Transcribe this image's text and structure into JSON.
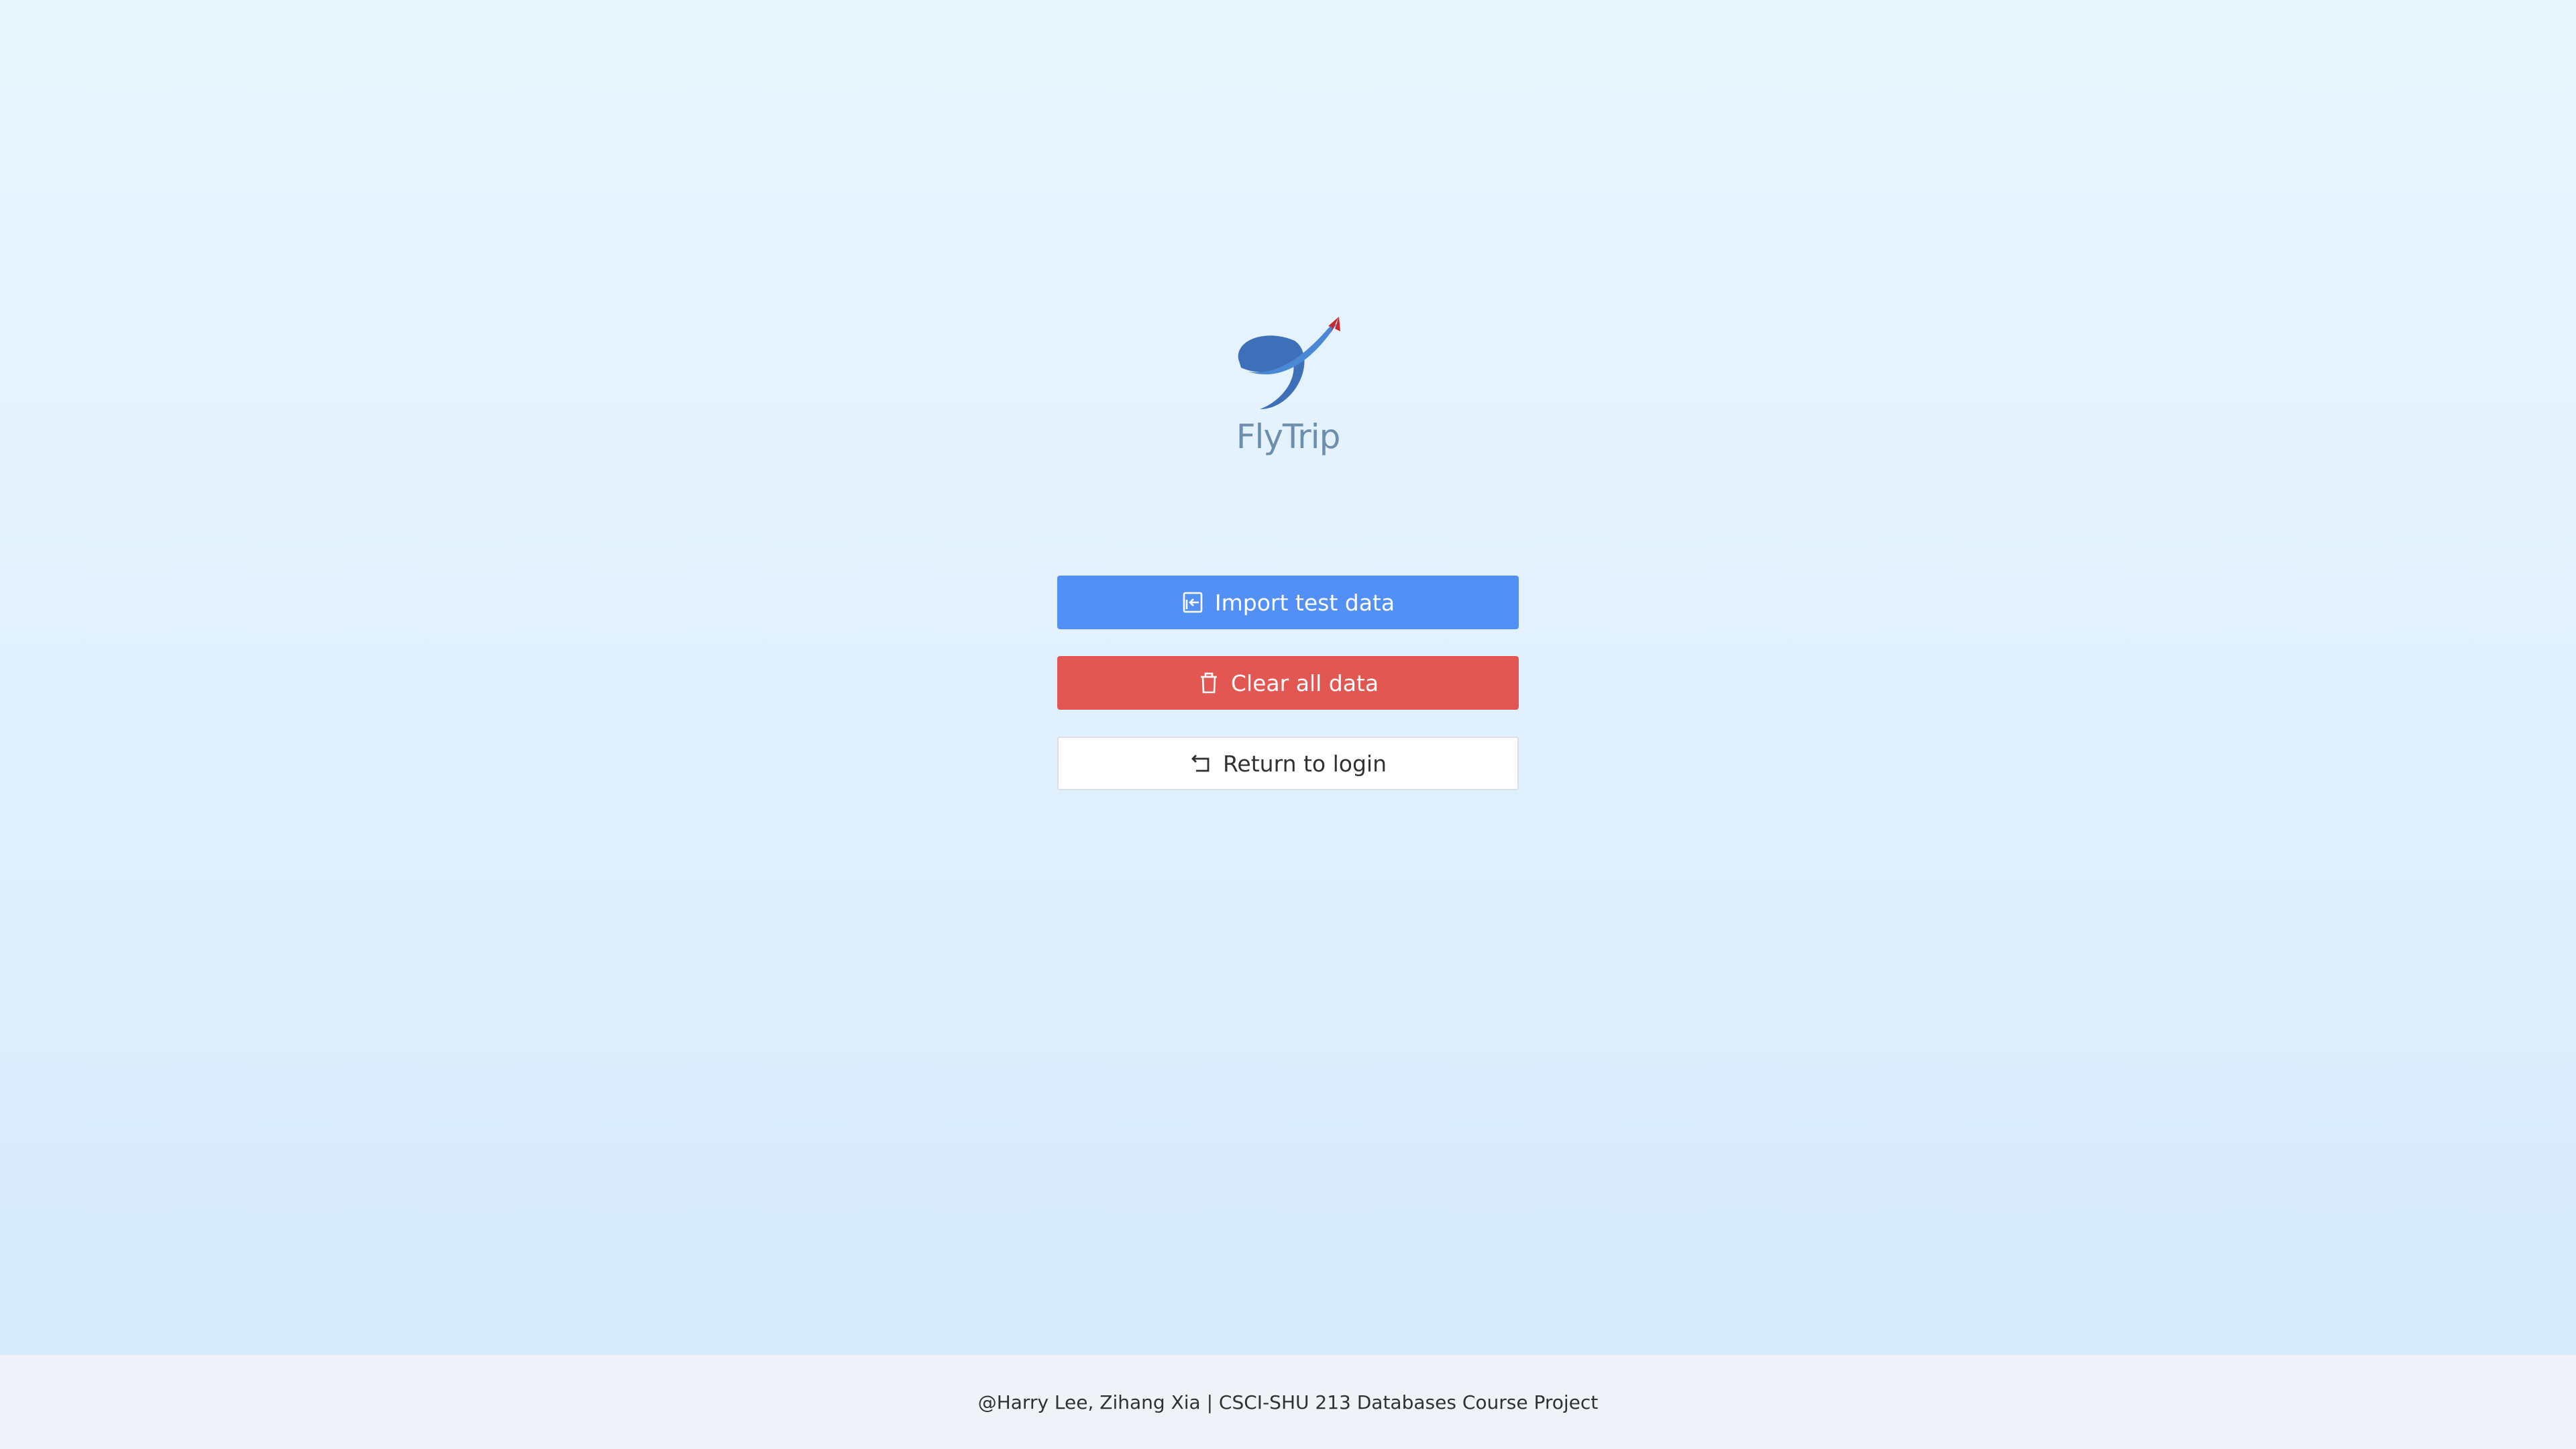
{
  "brand": {
    "name": "FlyTrip",
    "logo_icon": "flytrip-logo-icon",
    "colors": {
      "globe": "#3e6fb9",
      "swoosh": "#4a87d4",
      "arrow": "#c9282d",
      "text": "#6d8fad"
    }
  },
  "actions": {
    "import": {
      "label": "Import test data",
      "icon": "import-icon",
      "color": "#5290f6"
    },
    "clear": {
      "label": "Clear all data",
      "icon": "trash-icon",
      "color": "#e25752"
    },
    "return": {
      "label": "Return to login",
      "icon": "return-icon",
      "color": "#ffffff"
    }
  },
  "footer": {
    "text": "@Harry Lee, Zihang Xia | CSCI-SHU 213 Databases Course Project"
  }
}
